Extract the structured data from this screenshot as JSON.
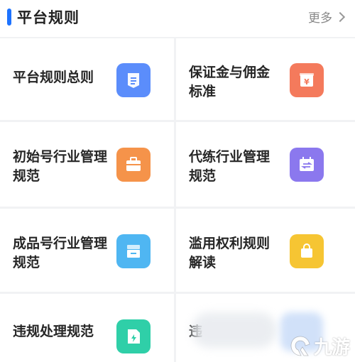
{
  "header": {
    "title": "平台规则",
    "more_label": "更多"
  },
  "items": [
    {
      "label": "平台规则总则",
      "icon": "document-icon",
      "color": "#5b8dfb"
    },
    {
      "label": "保证金与佣金标准",
      "icon": "yuan-icon",
      "color": "#f47a5c"
    },
    {
      "label": "初始号行业管理规范",
      "icon": "briefcase-icon",
      "color": "#f5934a"
    },
    {
      "label": "代练行业管理规范",
      "icon": "transfer-icon",
      "color": "#8b78ee"
    },
    {
      "label": "成品号行业管理规范",
      "icon": "store-icon",
      "color": "#4fb6f2"
    },
    {
      "label": "滥用权利规则解读",
      "icon": "bag-icon",
      "color": "#f6c533"
    },
    {
      "label": "违规处理规范",
      "icon": "lightning-doc-icon",
      "color": "#2fcfa8"
    },
    {
      "label": "违",
      "icon": "",
      "color": "#9cc1f5"
    }
  ],
  "watermark": {
    "text": "九游"
  }
}
